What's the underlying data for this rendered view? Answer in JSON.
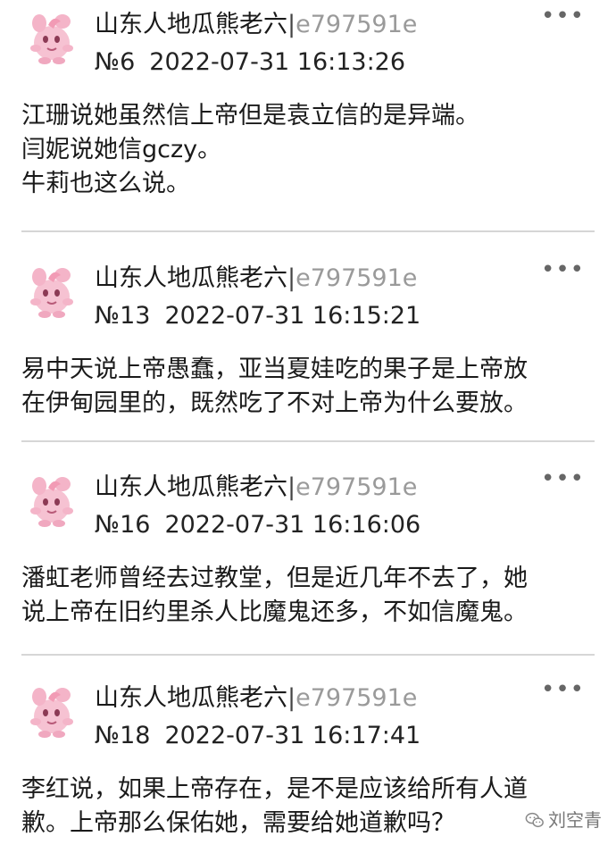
{
  "posts": [
    {
      "username": "山东人地瓜熊老六",
      "separator": "|",
      "uid": "e797591e",
      "floor": "№6",
      "timestamp": "2022-07-31 16:13:26",
      "lines": [
        "江珊说她虽然信上帝但是袁立信的是异端。",
        "闫妮说她信gczy。",
        "牛莉也这么说。"
      ]
    },
    {
      "username": "山东人地瓜熊老六",
      "separator": "|",
      "uid": "e797591e",
      "floor": "№13",
      "timestamp": "2022-07-31 16:15:21",
      "lines": [
        "易中天说上帝愚蠢，亚当夏娃吃的果子是上帝放",
        "在伊甸园里的，既然吃了不对上帝为什么要放。"
      ]
    },
    {
      "username": "山东人地瓜熊老六",
      "separator": "|",
      "uid": "e797591e",
      "floor": "№16",
      "timestamp": "2022-07-31 16:16:06",
      "lines": [
        "潘虹老师曾经去过教堂，但是近几年不去了，她",
        "说上帝在旧约里杀人比魔鬼还多，不如信魔鬼。"
      ]
    },
    {
      "username": "山东人地瓜熊老六",
      "separator": "|",
      "uid": "e797591e",
      "floor": "№18",
      "timestamp": "2022-07-31 16:17:41",
      "lines": [
        "李红说，如果上帝存在，是不是应该给所有人道",
        "歉。上帝那么保佑她，需要给她道歉吗？"
      ]
    }
  ],
  "more_label": "•••",
  "watermark": {
    "text": "刘空青",
    "icon": "wechat-icon"
  },
  "colors": {
    "uid": "#9a9a9a",
    "divider": "#d6d6d6",
    "avatar_pink": "#f4b4c8"
  }
}
